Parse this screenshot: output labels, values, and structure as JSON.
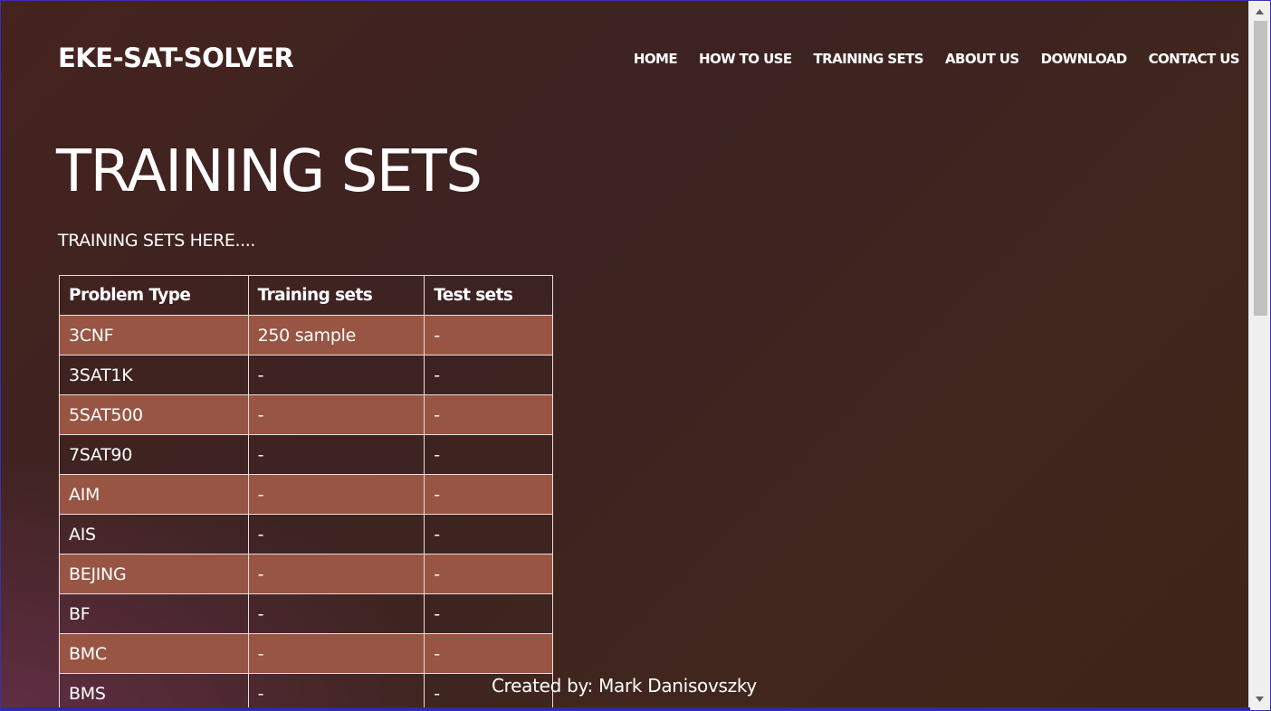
{
  "header": {
    "brand": "EKE-SAT-SOLVER",
    "nav": [
      {
        "id": "home",
        "label": "HOME"
      },
      {
        "id": "how-to-use",
        "label": "HOW TO USE"
      },
      {
        "id": "training-sets",
        "label": "TRAINING SETS"
      },
      {
        "id": "about-us",
        "label": "ABOUT US"
      },
      {
        "id": "download",
        "label": "DOWNLOAD"
      },
      {
        "id": "contact-us",
        "label": "CONTACT US"
      }
    ]
  },
  "main": {
    "title": "TRAINING SETS",
    "lead": "TRAINING SETS HERE....",
    "table": {
      "headers": [
        "Problem Type",
        "Training sets",
        "Test sets"
      ],
      "rows": [
        [
          "3CNF",
          "250 sample",
          "-"
        ],
        [
          "3SAT1K",
          "-",
          "-"
        ],
        [
          "5SAT500",
          "-",
          "-"
        ],
        [
          "7SAT90",
          "-",
          "-"
        ],
        [
          "AIM",
          "-",
          "-"
        ],
        [
          "AIS",
          "-",
          "-"
        ],
        [
          "BEJING",
          "-",
          "-"
        ],
        [
          "BF",
          "-",
          "-"
        ],
        [
          "BMC",
          "-",
          "-"
        ],
        [
          "BMS",
          "-",
          "-"
        ]
      ]
    }
  },
  "footer": {
    "credit": "Created by: Mark Danisovszky"
  },
  "scrollbar": {
    "up_icon": "triangle-up-icon",
    "down_icon": "triangle-down-icon"
  },
  "colors": {
    "background": "#3e2421",
    "row_accent": "#985543",
    "table_border": "#e9ddd8",
    "text": "#ffffff"
  }
}
